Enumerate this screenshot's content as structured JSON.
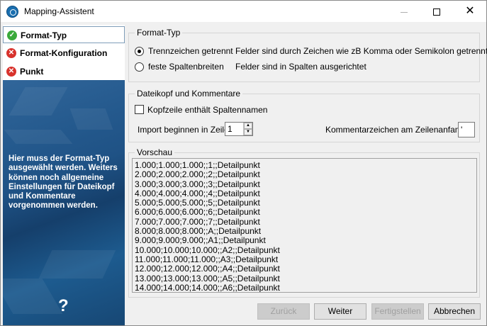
{
  "window": {
    "title": "Mapping-Assistent",
    "icon": "app-logo-icon"
  },
  "left_panel": {
    "steps": [
      {
        "label": "Format-Typ",
        "status": "done",
        "icon": "check-icon"
      },
      {
        "label": "Format-Konfiguration",
        "status": "error",
        "icon": "error-icon"
      },
      {
        "label": "Punkt",
        "status": "error",
        "icon": "error-icon"
      }
    ],
    "description": "Hier muss der Format-Typ ausgewählt werden. Weiters können noch allgemeine Einstellungen für Dateikopf und Kommentare vorgenommen werden.",
    "help": "?"
  },
  "format_group": {
    "title": "Format-Typ",
    "options": [
      {
        "label": "Trennzeichen getrennt",
        "description": "Felder sind durch Zeichen wie zB Komma oder Semikolon getrennt",
        "selected": true
      },
      {
        "label": "feste Spaltenbreiten",
        "description": "Felder sind in Spalten ausgerichtet",
        "selected": false
      }
    ]
  },
  "header_group": {
    "title": "Dateikopf und Kommentare",
    "header_checkbox_label": "Kopfzeile enthält Spaltennamen",
    "header_checked": false,
    "import_label": "Import beginnen in Zeile:",
    "import_value": "1",
    "comment_label": "Kommentarzeichen am Zeilenanfang:",
    "comment_value": "'"
  },
  "preview_group": {
    "title": "Vorschau",
    "lines": [
      "1.000;1.000;1.000;;1;;Detailpunkt",
      "2.000;2.000;2.000;;2;;Detailpunkt",
      "3.000;3.000;3.000;;3;;Detailpunkt",
      "4.000;4.000;4.000;;4;;Detailpunkt",
      "5.000;5.000;5.000;;5;;Detailpunkt",
      "6.000;6.000;6.000;;6;;Detailpunkt",
      "7.000;7.000;7.000;;7;;Detailpunkt",
      "8.000;8.000;8.000;;A;;Detailpunkt",
      "9.000;9.000;9.000;;A1;;Detailpunkt",
      "10.000;10.000;10.000;;A2;;Detailpunkt",
      "11.000;11.000;11.000;;A3;;Detailpunkt",
      "12.000;12.000;12.000;;A4;;Detailpunkt",
      "13.000;13.000;13.000;;A5;;Detailpunkt",
      "14.000;14.000;14.000;;A6;;Detailpunkt"
    ]
  },
  "buttons": {
    "back": "Zurück",
    "next": "Weiter",
    "finish": "Fertigstellen",
    "cancel": "Abbrechen"
  }
}
